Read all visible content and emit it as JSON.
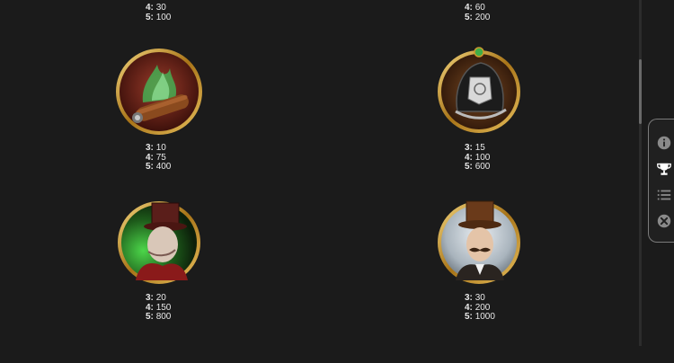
{
  "paytable": {
    "top_partial": [
      {
        "rows": [
          {
            "count": "4:",
            "value": "30"
          },
          {
            "count": "5:",
            "value": "100"
          }
        ]
      },
      {
        "rows": [
          {
            "count": "4:",
            "value": "60"
          },
          {
            "count": "5:",
            "value": "200"
          }
        ]
      }
    ],
    "symbols": [
      {
        "name": "cigar",
        "rows": [
          {
            "count": "3:",
            "value": "10"
          },
          {
            "count": "4:",
            "value": "75"
          },
          {
            "count": "5:",
            "value": "400"
          }
        ]
      },
      {
        "name": "police-helmet",
        "rows": [
          {
            "count": "3:",
            "value": "15"
          },
          {
            "count": "4:",
            "value": "100"
          },
          {
            "count": "5:",
            "value": "600"
          }
        ]
      },
      {
        "name": "villain-top-hat",
        "rows": [
          {
            "count": "3:",
            "value": "20"
          },
          {
            "count": "4:",
            "value": "150"
          },
          {
            "count": "5:",
            "value": "800"
          }
        ]
      },
      {
        "name": "gentleman-mustache",
        "rows": [
          {
            "count": "3:",
            "value": "30"
          },
          {
            "count": "4:",
            "value": "200"
          },
          {
            "count": "5:",
            "value": "1000"
          }
        ]
      }
    ]
  },
  "side_menu": {
    "items": [
      {
        "icon": "info-icon",
        "active": false
      },
      {
        "icon": "trophy-icon",
        "active": true
      },
      {
        "icon": "list-icon",
        "active": false
      },
      {
        "icon": "close-icon",
        "active": false
      }
    ]
  },
  "colors": {
    "background": "#1b1b1b",
    "text": "#e8e8e8",
    "gold_frame": "#c9992e",
    "menu_border": "#7b7b7b",
    "icon_inactive": "#8a8a8a",
    "icon_active": "#ffffff"
  }
}
